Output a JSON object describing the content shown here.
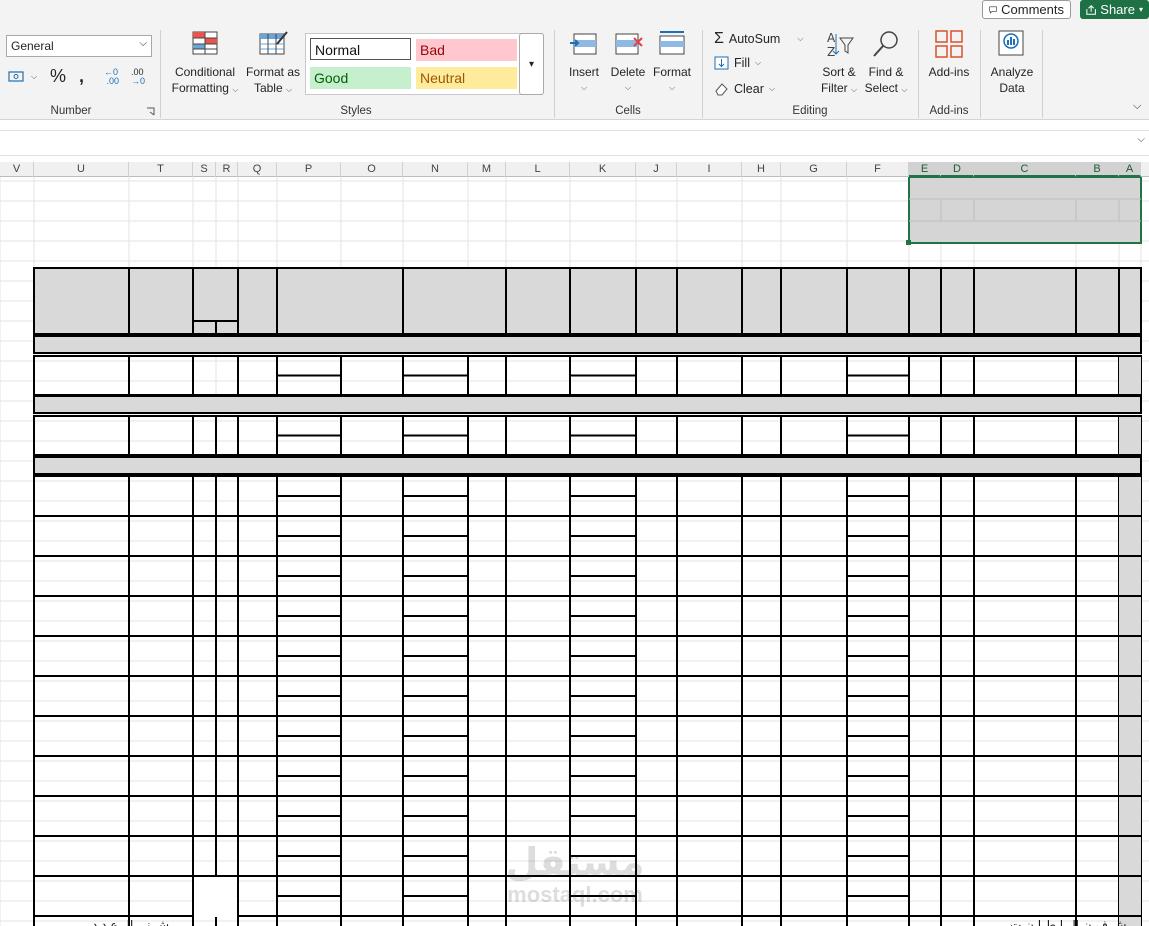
{
  "top": {
    "comments": "Comments",
    "share": "Share"
  },
  "ribbon": {
    "number": {
      "format_value": "General",
      "percent": "%",
      "comma": ",",
      "inc_decimal": ".00",
      "dec_decimal": ".00",
      "label": "Number"
    },
    "styles": {
      "conditional": [
        "Conditional",
        "Formatting"
      ],
      "format_table": [
        "Format as",
        "Table"
      ],
      "normal": "Normal",
      "bad": "Bad",
      "good": "Good",
      "neutral": "Neutral",
      "label": "Styles"
    },
    "cells": {
      "insert": "Insert",
      "delete": "Delete",
      "format": "Format",
      "label": "Cells"
    },
    "editing": {
      "autosum": "AutoSum",
      "fill": "Fill",
      "clear": "Clear",
      "sort": [
        "Sort &",
        "Filter"
      ],
      "find": [
        "Find &",
        "Select"
      ],
      "label": "Editing"
    },
    "addins": {
      "addins": "Add-ins",
      "label": "Add-ins"
    },
    "analyze": [
      "Analyze",
      "Data"
    ]
  },
  "sheet": {
    "columns": [
      "V",
      "U",
      "T",
      "S",
      "R",
      "Q",
      "P",
      "O",
      "N",
      "M",
      "L",
      "K",
      "J",
      "I",
      "H",
      "G",
      "F",
      "E",
      "D",
      "C",
      "B",
      "A"
    ],
    "selected_columns": [
      "E",
      "D",
      "C",
      "B",
      "A"
    ]
  },
  "watermark": {
    "arabic": "مستقل",
    "latin": "mostaql.com"
  },
  "footer": {
    "left": "ش ني ال ع د د",
    "right": "ش ف ن ال ا ط ا ن ت"
  }
}
